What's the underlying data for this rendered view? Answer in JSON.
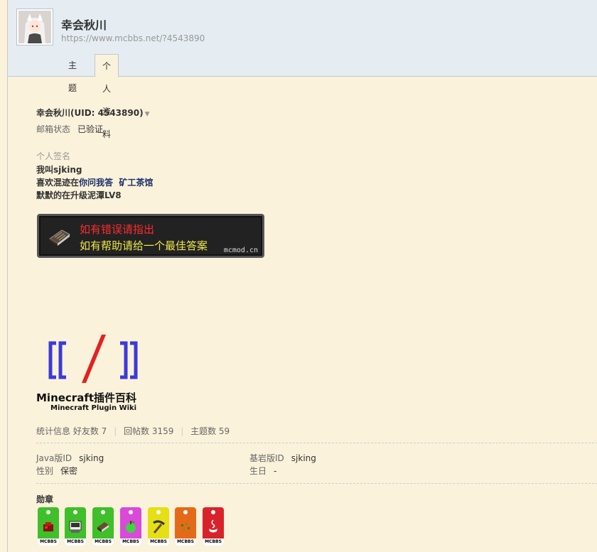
{
  "profile": {
    "name": "幸会秋川",
    "url": "https://www.mcbbs.net/?4543890",
    "uid_line": "幸会秋川(UID: 4543890)"
  },
  "tabs": [
    {
      "label": "主题"
    },
    {
      "label": "个人资料"
    }
  ],
  "mail": {
    "label": "邮箱状态",
    "value": "已验证"
  },
  "signature": {
    "label": "个人签名",
    "line1": "我叫sjking",
    "line2_prefix": "喜欢混迹在",
    "link1": "你问我答",
    "link2": "矿工茶馆",
    "line3": "默默的在升级泥潭LV8"
  },
  "banner": {
    "line1": "如有错误请指出",
    "line2": "如有帮助请给一个最佳答案",
    "site": "mcmod.cn",
    "colors": {
      "red": "#ff2b2b",
      "yellow": "#f0e64a"
    }
  },
  "wiki": {
    "title": "Minecraft插件百科",
    "subtitle": "Minecraft Plugin Wiki"
  },
  "stats": {
    "label": "统计信息",
    "friends": "好友数 7",
    "posts": "回帖数 3159",
    "threads": "主题数 59"
  },
  "info": {
    "java_label": "Java版ID",
    "java_value": "sjking",
    "bedrock_label": "基岩版ID",
    "bedrock_value": "sjking",
    "gender_label": "性别",
    "gender_value": "保密",
    "birthday_label": "生日",
    "birthday_value": "-"
  },
  "medals": {
    "title": "勋章",
    "items": [
      {
        "name": "redstone-medal",
        "color": "#3fbf2a",
        "footer": "MCBBS"
      },
      {
        "name": "console-medal",
        "color": "#3fbf2a",
        "footer": "MCBBS"
      },
      {
        "name": "book-medal",
        "color": "#3fbf2a",
        "footer": "MCBBS"
      },
      {
        "name": "apple-medal",
        "color": "#d94ad9",
        "footer": "MCBBS"
      },
      {
        "name": "pickaxe-medal",
        "color": "#e5e014",
        "footer": "MCBBS"
      },
      {
        "name": "seeds-medal",
        "color": "#e56a17",
        "footer": "MCBBS"
      },
      {
        "name": "java-medal",
        "color": "#d8232a",
        "footer": "MCBBS"
      }
    ]
  }
}
